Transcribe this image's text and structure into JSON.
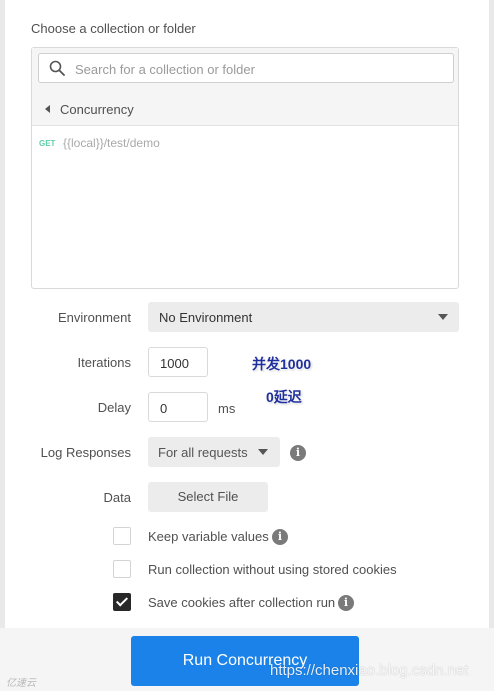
{
  "collection": {
    "label": "Choose a collection or folder",
    "search_placeholder": "Search for a collection or folder",
    "current_folder": "Concurrency",
    "requests": [
      {
        "method": "GET",
        "url": "{{local}}/test/demo"
      }
    ]
  },
  "fields": {
    "environment": {
      "label": "Environment",
      "value": "No Environment"
    },
    "iterations": {
      "label": "Iterations",
      "value": "1000"
    },
    "delay": {
      "label": "Delay",
      "value": "0",
      "unit": "ms"
    },
    "log_responses": {
      "label": "Log Responses",
      "value": "For all requests"
    },
    "data": {
      "label": "Data",
      "button": "Select File"
    }
  },
  "options": [
    {
      "label": "Keep variable values",
      "checked": false,
      "info": true
    },
    {
      "label": "Run collection without using stored cookies",
      "checked": false,
      "info": false
    },
    {
      "label": "Save cookies after collection run",
      "checked": true,
      "info": true
    }
  ],
  "annotations": {
    "iterations_note": "并发1000",
    "delay_note": "0延迟"
  },
  "run_button": "Run Concurrency",
  "watermark": {
    "url": "https://chenxiao.blog.csdn.net",
    "left": "亿速云"
  },
  "icons": {
    "search": "search-icon",
    "back": "back-arrow-icon",
    "caret": "caret-down-icon",
    "info": "info-icon",
    "check": "checkmark-icon"
  },
  "colors": {
    "primary": "#1a82e8",
    "method_get": "#5fd0a6",
    "checked_box": "#282828"
  }
}
